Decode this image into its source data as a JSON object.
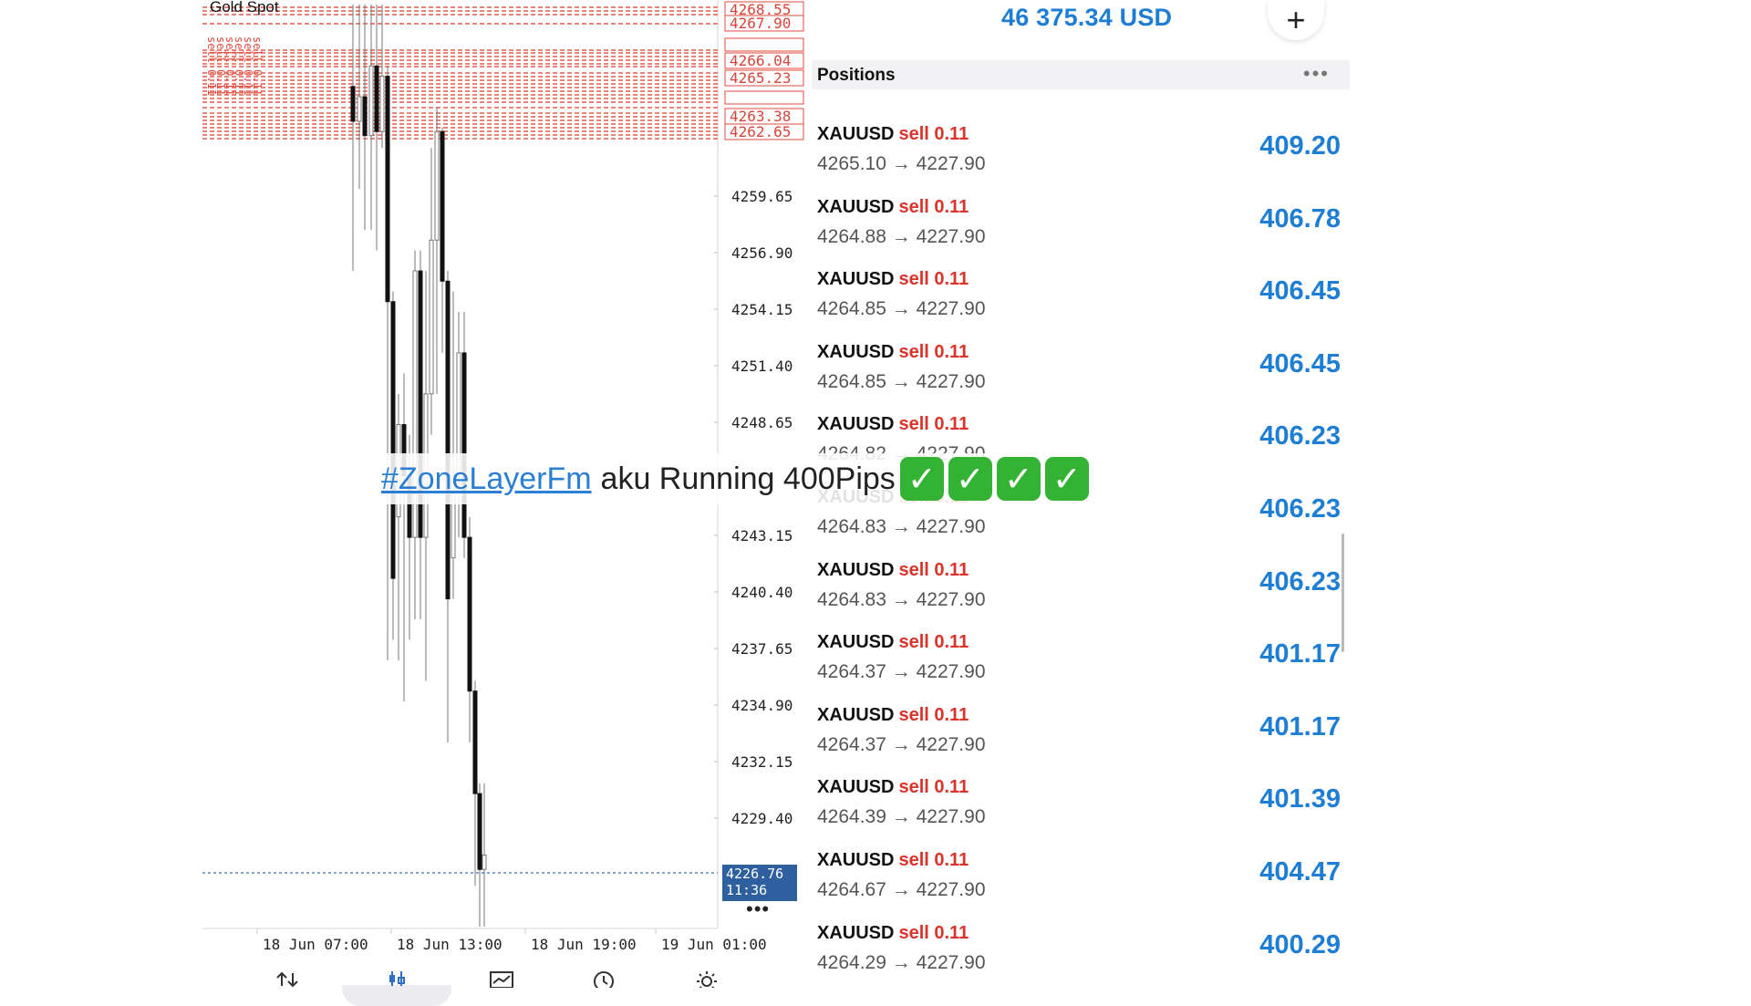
{
  "chart": {
    "symbol": "Gold Spot",
    "price_axis": [
      "4259.65",
      "4256.90",
      "4254.15",
      "4251.40",
      "4248.65",
      "4243.15",
      "4240.40",
      "4237.65",
      "4234.90",
      "4232.15",
      "4229.40"
    ],
    "order_level_labels": [
      "4268.55",
      "4267.90",
      "4266.04",
      "4265.23",
      "4263.38",
      "4262.65"
    ],
    "order_line_label": "sell 0.11",
    "time_axis": [
      "18 Jun 07:00",
      "18 Jun 13:00",
      "18 Jun 19:00",
      "19 Jun 01:00"
    ],
    "current_price": "4226.76",
    "countdown": "11:36",
    "more_icon": "•••",
    "tabs": [
      {
        "name": "quotes",
        "icon": "arrows-updown-icon",
        "active": false
      },
      {
        "name": "chart",
        "icon": "candles-icon",
        "active": true
      },
      {
        "name": "trade",
        "icon": "trade-icon",
        "active": false
      },
      {
        "name": "history",
        "icon": "clock-icon",
        "active": false
      },
      {
        "name": "settings",
        "icon": "gear-icon",
        "active": false
      }
    ]
  },
  "account": {
    "balance": "46 375.34 USD",
    "add_icon": "+"
  },
  "positions": {
    "title": "Positions",
    "more_icon": "•••",
    "rows": [
      {
        "symbol": "XAUUSD",
        "side": "sell 0.11",
        "open": "4265.10",
        "current": "4227.90",
        "profit": "409.20"
      },
      {
        "symbol": "XAUUSD",
        "side": "sell 0.11",
        "open": "4264.88",
        "current": "4227.90",
        "profit": "406.78"
      },
      {
        "symbol": "XAUUSD",
        "side": "sell 0.11",
        "open": "4264.85",
        "current": "4227.90",
        "profit": "406.45"
      },
      {
        "symbol": "XAUUSD",
        "side": "sell 0.11",
        "open": "4264.85",
        "current": "4227.90",
        "profit": "406.45"
      },
      {
        "symbol": "XAUUSD",
        "side": "sell 0.11",
        "open": "4264.82",
        "current": "4227.90",
        "profit": "406.23"
      },
      {
        "symbol": "XAUUSD",
        "side": "sell 0.11",
        "open": "4264.83",
        "current": "4227.90",
        "profit": "406.23"
      },
      {
        "symbol": "XAUUSD",
        "side": "sell 0.11",
        "open": "4264.83",
        "current": "4227.90",
        "profit": "406.23"
      },
      {
        "symbol": "XAUUSD",
        "side": "sell 0.11",
        "open": "4264.37",
        "current": "4227.90",
        "profit": "401.17"
      },
      {
        "symbol": "XAUUSD",
        "side": "sell 0.11",
        "open": "4264.37",
        "current": "4227.90",
        "profit": "401.17"
      },
      {
        "symbol": "XAUUSD",
        "side": "sell 0.11",
        "open": "4264.39",
        "current": "4227.90",
        "profit": "401.39"
      },
      {
        "symbol": "XAUUSD",
        "side": "sell 0.11",
        "open": "4264.67",
        "current": "4227.90",
        "profit": "404.47"
      },
      {
        "symbol": "XAUUSD",
        "side": "sell 0.11",
        "open": "4264.29",
        "current": "4227.90",
        "profit": "400.29"
      }
    ]
  },
  "caption": {
    "hashtag": "#ZoneLayerFm",
    "text": "aku Running 400Pips",
    "checks": [
      "✓",
      "✓",
      "✓",
      "✓"
    ]
  },
  "colors": {
    "profit": "#1e7ed4",
    "sell": "#d9332a",
    "order_line": "#e04a3c",
    "price_tag": "#2e5f9f",
    "check": "#34b233"
  }
}
